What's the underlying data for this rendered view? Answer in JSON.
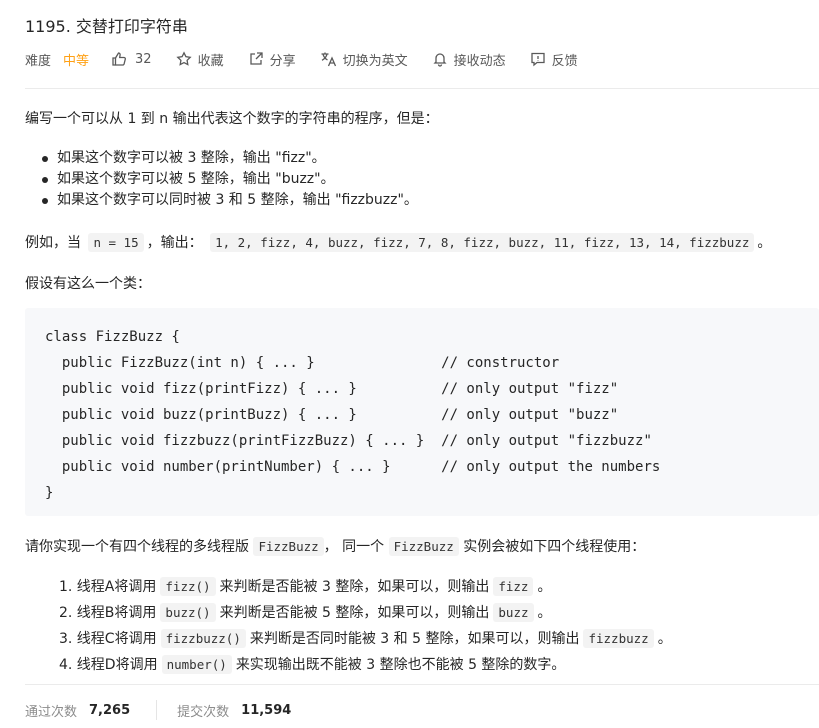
{
  "problem": {
    "title": "1195. 交替打印字符串"
  },
  "toolbar": {
    "difficulty_label": "难度",
    "difficulty_value": "中等",
    "likes": "32",
    "favorite": "收藏",
    "share": "分享",
    "switch_lang": "切换为英文",
    "notify": "接收动态",
    "feedback": "反馈"
  },
  "description": {
    "intro": "编写一个可以从 1 到 n 输出代表这个数字的字符串的程序，但是：",
    "bullets": [
      "如果这个数字可以被 3 整除，输出 \"fizz\"。",
      "如果这个数字可以被 5 整除，输出 \"buzz\"。",
      "如果这个数字可以同时被 3 和 5 整除，输出 \"fizzbuzz\"。"
    ],
    "example_prefix": "例如，当",
    "example_n": "n = 15",
    "example_mid": "，输出：",
    "example_output": "1, 2, fizz, 4, buzz, fizz, 7, 8, fizz, buzz, 11, fizz, 13, 14, fizzbuzz",
    "example_suffix": "。",
    "class_intro": "假设有这么一个类：",
    "code": "class FizzBuzz {\n  public FizzBuzz(int n) { ... }               // constructor\n  public void fizz(printFizz) { ... }          // only output \"fizz\"\n  public void buzz(printBuzz) { ... }          // only output \"buzz\"\n  public void fizzbuzz(printFizzBuzz) { ... }  // only output \"fizzbuzz\"\n  public void number(printNumber) { ... }      // only output the numbers\n}",
    "impl_prefix": "请你实现一个有四个线程的多线程版",
    "impl_code1": "FizzBuzz",
    "impl_mid": "，  同一个",
    "impl_code2": "FizzBuzz",
    "impl_suffix": "实例会被如下四个线程使用：",
    "steps": [
      {
        "pre": "1. 线程A将调用",
        "code": "fizz()",
        "mid": "来判断是否能被 3 整除，如果可以，则输出",
        "code2": "fizz",
        "post": "。"
      },
      {
        "pre": "2. 线程B将调用",
        "code": "buzz()",
        "mid": "来判断是否能被 5 整除，如果可以，则输出",
        "code2": "buzz",
        "post": "。"
      },
      {
        "pre": "3. 线程C将调用",
        "code": "fizzbuzz()",
        "mid": "来判断是否同时能被 3 和 5 整除，如果可以，则输出",
        "code2": "fizzbuzz",
        "post": "。"
      },
      {
        "pre": "4. 线程D将调用",
        "code": "number()",
        "mid": "来实现输出既不能被 3 整除也不能被 5 整除的数字。",
        "code2": "",
        "post": ""
      }
    ]
  },
  "stats": {
    "accepted_label": "通过次数",
    "accepted_value": "7,265",
    "submitted_label": "提交次数",
    "submitted_value": "11,594"
  }
}
